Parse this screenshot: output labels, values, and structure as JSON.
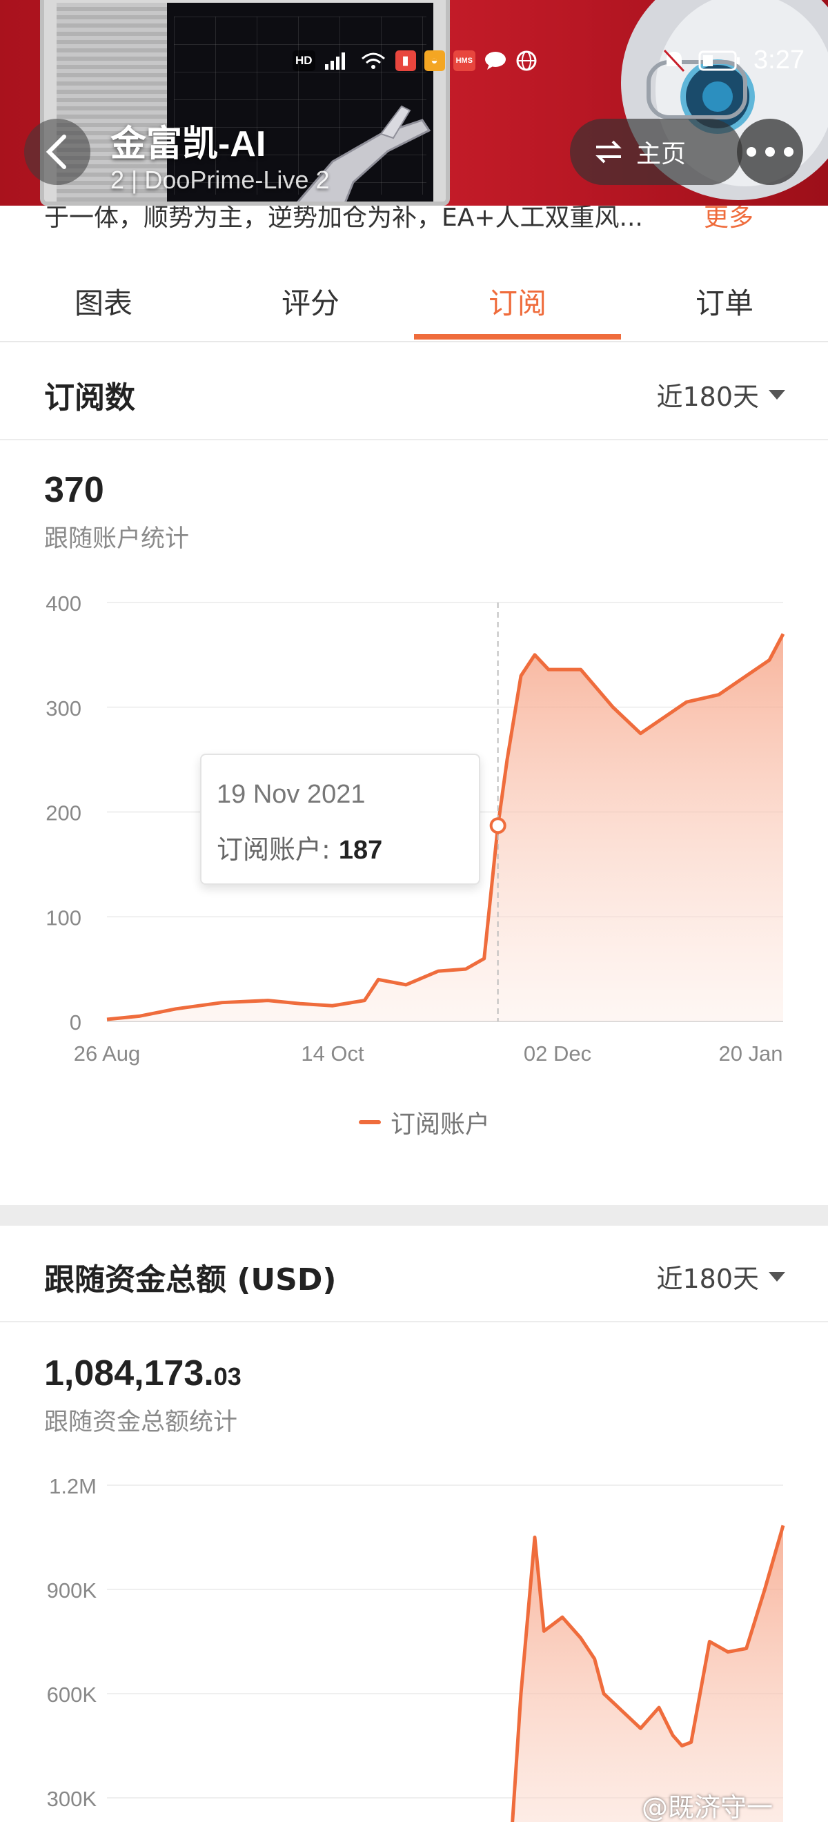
{
  "status_bar": {
    "time": "3:27",
    "indicators": [
      "HD",
      "HMS"
    ]
  },
  "header": {
    "title": "金富凯-AI",
    "subtitle": "2 | DooPrime-Live 2",
    "home_label": "主页",
    "back_icon": "chevron-left-icon",
    "home_icon": "swap-icon",
    "more_icon": "more-dots-icon"
  },
  "description": {
    "text": "于一体，顺势为主，逆势加仓为补，EA+人工双重风...",
    "more_label": "更多"
  },
  "tabs": [
    {
      "label": "图表",
      "active": false
    },
    {
      "label": "评分",
      "active": false
    },
    {
      "label": "订阅",
      "active": true
    },
    {
      "label": "订单",
      "active": false
    }
  ],
  "subscriptions": {
    "title": "订阅数",
    "range_label": "近180天",
    "total": "370",
    "total_label": "跟随账户统计",
    "tooltip": {
      "date": "19 Nov 2021",
      "label": "订阅账户: ",
      "value": "187"
    },
    "legend": "订阅账户"
  },
  "funds": {
    "title": "跟随资金总额 (USD)",
    "range_label": "近180天",
    "total_int": "1,084,173.",
    "total_dec": "03",
    "total_label": "跟随资金总额统计"
  },
  "watermark": "@既济守一",
  "colors": {
    "accent": "#ef6c3c",
    "header_red": "#c81e2a"
  },
  "chart_data": [
    {
      "type": "area",
      "title": "订阅数",
      "series": [
        {
          "name": "订阅账户",
          "x": [
            "26 Aug",
            "2 Sep",
            "10 Sep",
            "20 Sep",
            "30 Sep",
            "7 Oct",
            "14 Oct",
            "21 Oct",
            "24 Oct",
            "30 Oct",
            "6 Nov",
            "12 Nov",
            "16 Nov",
            "19 Nov",
            "21 Nov",
            "24 Nov",
            "27 Nov",
            "30 Nov",
            "7 Dec",
            "14 Dec",
            "20 Dec",
            "25 Dec",
            "30 Dec",
            "6 Jan",
            "12 Jan",
            "17 Jan",
            "20 Jan"
          ],
          "y": [
            2,
            5,
            12,
            18,
            20,
            17,
            15,
            20,
            40,
            35,
            48,
            50,
            60,
            187,
            250,
            330,
            350,
            336,
            336,
            300,
            275,
            290,
            305,
            312,
            330,
            345,
            370
          ]
        }
      ],
      "xticks": [
        "26 Aug",
        "14 Oct",
        "02 Dec",
        "20 Jan"
      ],
      "ylim": [
        0,
        400
      ],
      "yticks": [
        0,
        100,
        200,
        300,
        400
      ],
      "highlight": {
        "x": "19 Nov 2021",
        "y": 187
      }
    },
    {
      "type": "area",
      "title": "跟随资金总额 (USD)",
      "series": [
        {
          "name": "",
          "x": [
            "21 Nov",
            "24 Nov",
            "27 Nov",
            "29 Nov",
            "1 Dec",
            "3 Dec",
            "7 Dec",
            "10 Dec",
            "12 Dec",
            "16 Dec",
            "20 Dec",
            "24 Dec",
            "27 Dec",
            "29 Dec",
            "31 Dec",
            "4 Jan",
            "8 Jan",
            "12 Jan",
            "16 Jan",
            "20 Jan"
          ],
          "y": [
            0,
            600000,
            1050000,
            780000,
            800000,
            820000,
            760000,
            700000,
            600000,
            550000,
            500000,
            560000,
            480000,
            450000,
            460000,
            750000,
            720000,
            730000,
            900000,
            1084173
          ]
        }
      ],
      "yticks": [
        "300K",
        "600K",
        "900K",
        "1.2M"
      ],
      "ylim": [
        0,
        1200000
      ]
    }
  ]
}
